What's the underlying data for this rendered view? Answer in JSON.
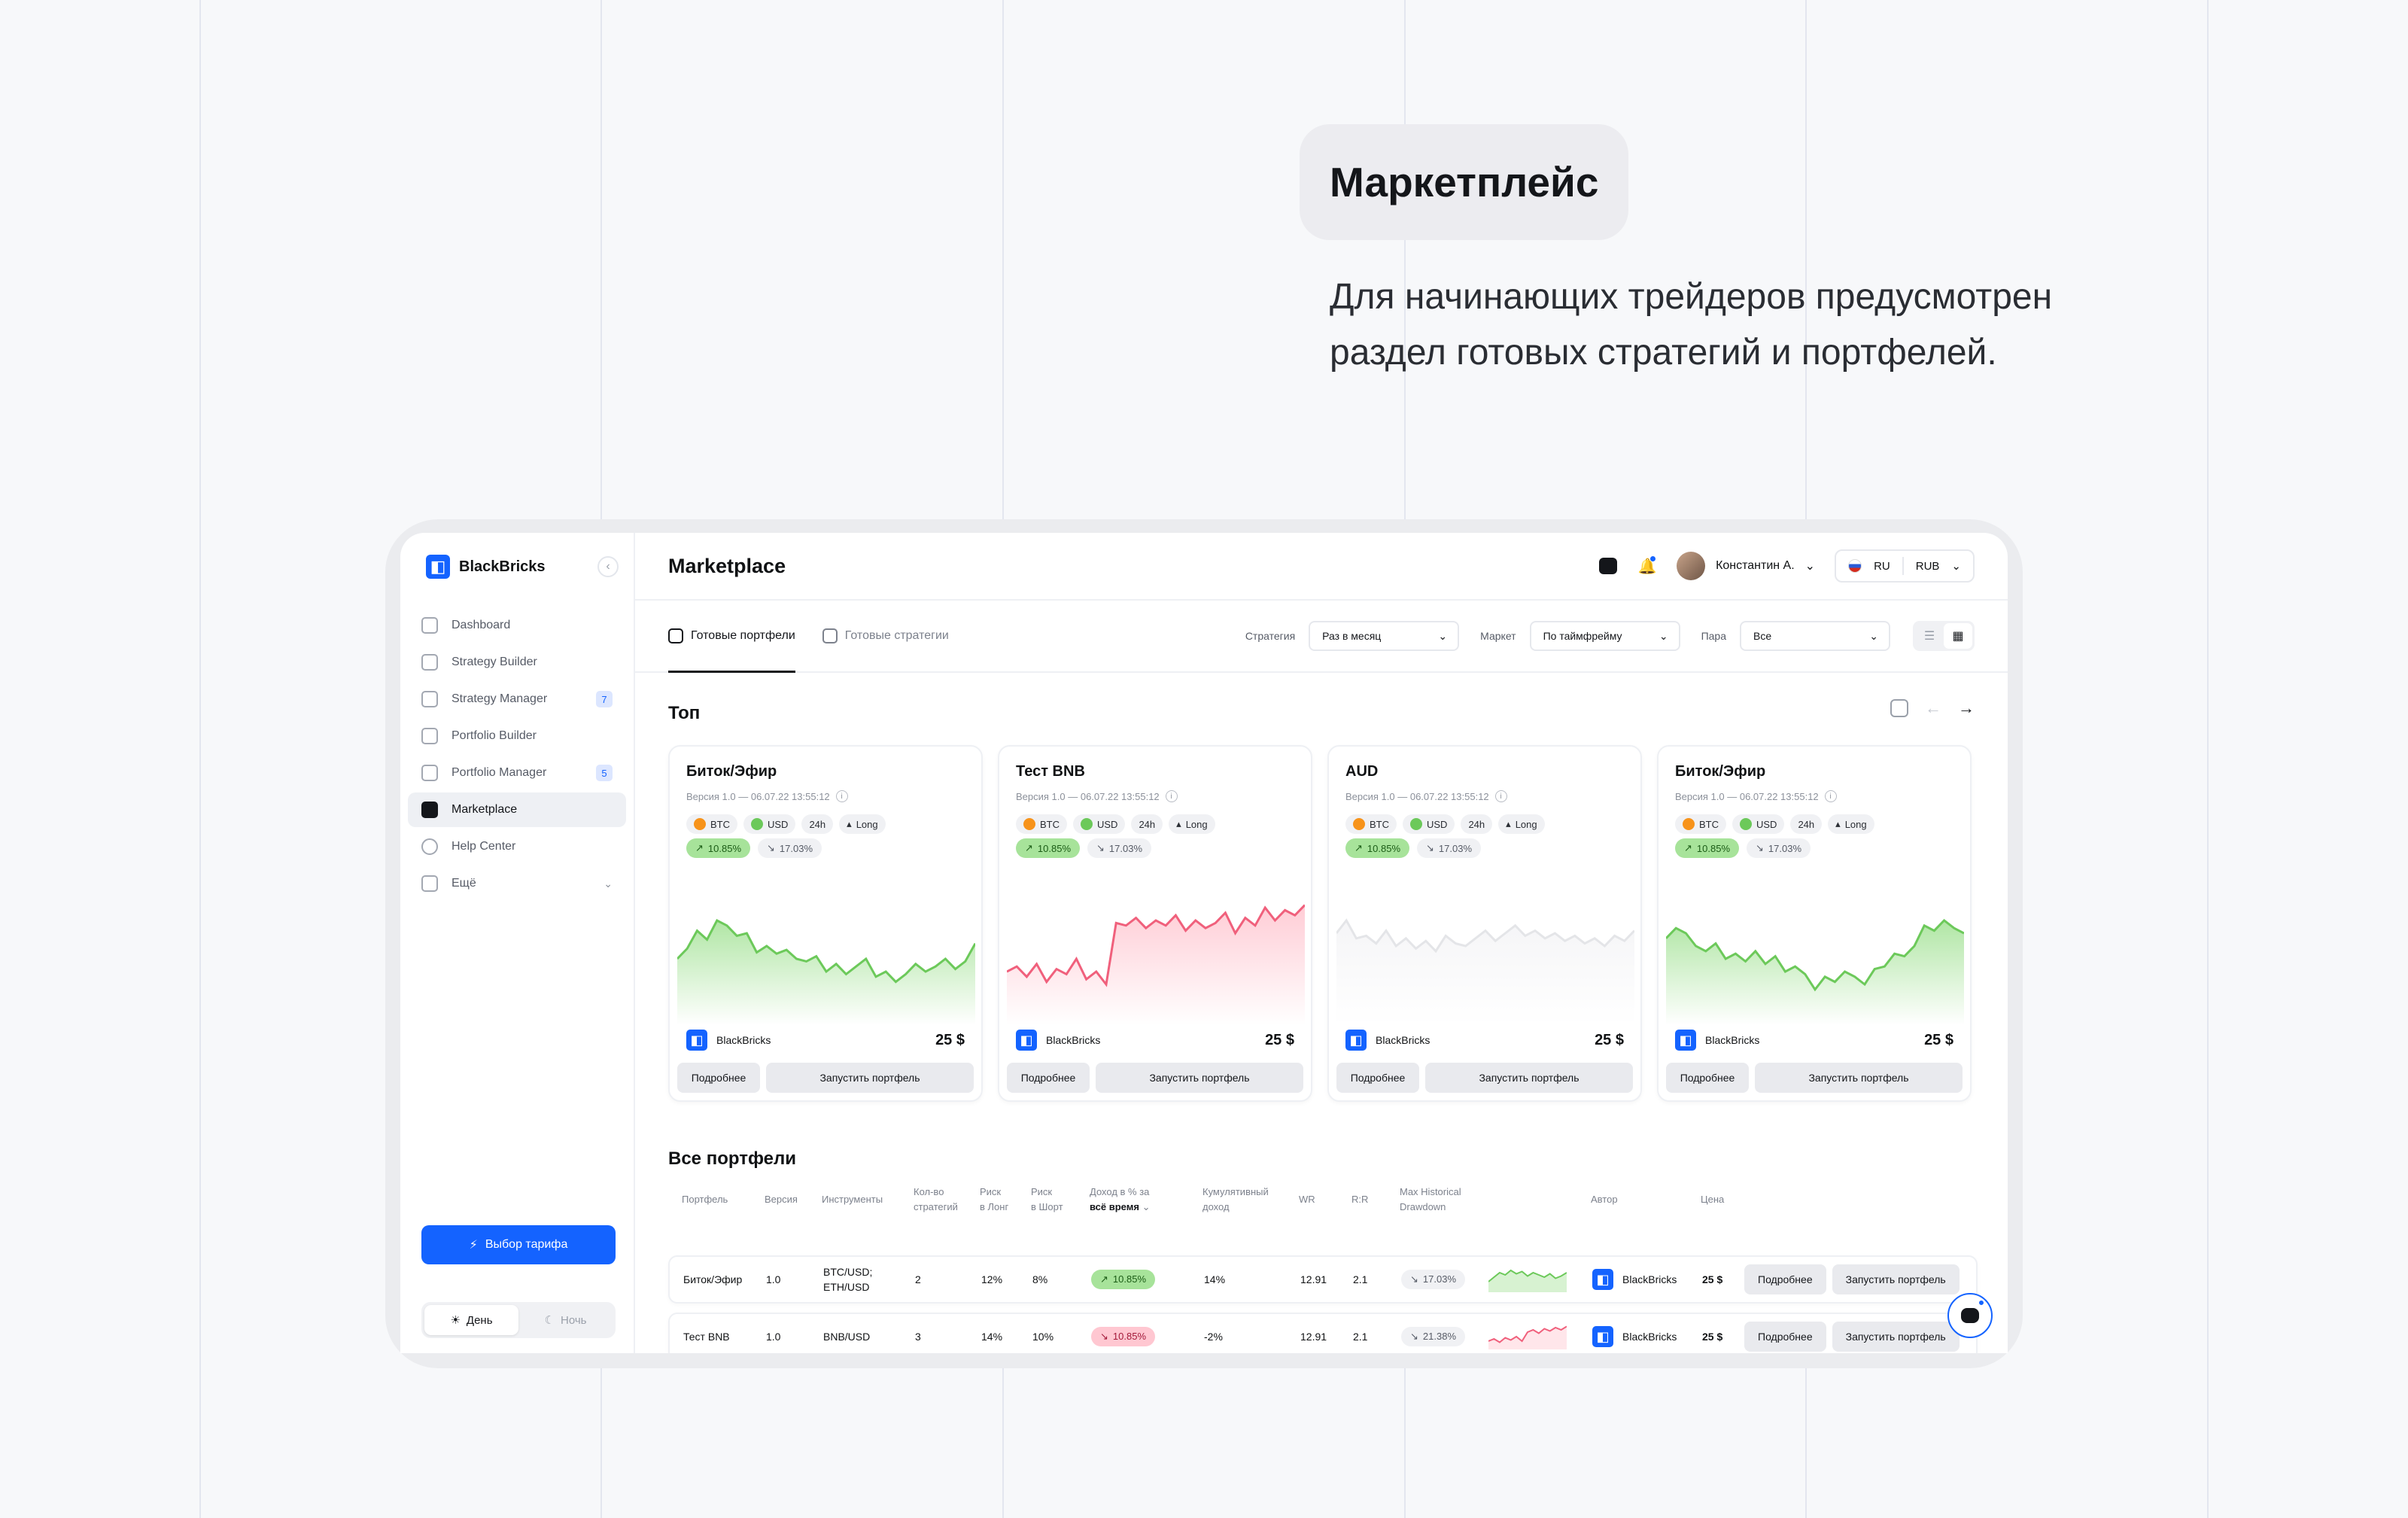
{
  "hero": {
    "heading": "Маркетплейс",
    "description": "Для начинающих трейдеров предусмотрен раздел готовых стратегий и портфелей."
  },
  "brand": {
    "name": "BlackBricks",
    "accent": "#1463ff"
  },
  "sidebar": {
    "items": [
      {
        "label": "Dashboard",
        "icon": "home-icon"
      },
      {
        "label": "Strategy Builder",
        "icon": "builder-icon"
      },
      {
        "label": "Strategy Manager",
        "icon": "grid-icon",
        "badge": "7"
      },
      {
        "label": "Portfolio Builder",
        "icon": "portfolio-add-icon"
      },
      {
        "label": "Portfolio Manager",
        "icon": "portfolio-icon",
        "badge": "5"
      },
      {
        "label": "Marketplace",
        "icon": "marketplace-icon",
        "active": true
      },
      {
        "label": "Help Center",
        "icon": "help-icon"
      },
      {
        "label": "Ещё",
        "icon": "more-icon",
        "expandable": true
      }
    ],
    "tariff_button": "Выбор тарифа",
    "theme": {
      "day": "День",
      "night": "Ночь",
      "selected": "day"
    }
  },
  "topbar": {
    "title": "Marketplace",
    "user_name": "Константин А.",
    "language": "RU",
    "currency": "RUB"
  },
  "tabs": [
    {
      "label": "Готовые портфели",
      "active": true
    },
    {
      "label": "Готовые стратегии",
      "active": false
    }
  ],
  "filters": {
    "strategy_label": "Стратегия",
    "strategy_value": "Раз в месяц",
    "market_label": "Маркет",
    "market_value": "По таймфрейму",
    "pair_label": "Пара",
    "pair_value": "Все"
  },
  "top": {
    "title": "Топ",
    "cards": [
      {
        "title": "Биток/Эфир",
        "version": "Версия 1.0 — 06.07.22 13:55:12",
        "chips": [
          "BTC",
          "USD",
          "24h",
          "Long"
        ],
        "perf_up": "10.85%",
        "perf_dd": "17.03%",
        "author": "BlackBricks",
        "price": "25 $",
        "btn_more": "Подробнее",
        "btn_run": "Запустить портфель",
        "trend": "green",
        "series": [
          40,
          48,
          62,
          55,
          70,
          66,
          58,
          60,
          45,
          50,
          44,
          47,
          40,
          38,
          42,
          30,
          36,
          28,
          34,
          40,
          26,
          30,
          22,
          28,
          36,
          30,
          34,
          40,
          32,
          38,
          52
        ]
      },
      {
        "title": "Тест BNB",
        "version": "Версия 1.0 — 06.07.22 13:55:12",
        "chips": [
          "BTC",
          "USD",
          "24h",
          "Long"
        ],
        "perf_up": "10.85%",
        "perf_dd": "17.03%",
        "author": "BlackBricks",
        "price": "25 $",
        "btn_more": "Подробнее",
        "btn_run": "Запустить портфель",
        "trend": "red",
        "series": [
          30,
          34,
          26,
          36,
          22,
          32,
          28,
          40,
          24,
          30,
          20,
          68,
          66,
          72,
          64,
          70,
          66,
          74,
          62,
          70,
          64,
          68,
          76,
          60,
          72,
          66,
          80,
          70,
          78,
          74,
          82
        ]
      },
      {
        "title": "AUD",
        "version": "Версия 1.0 — 06.07.22 13:55:12",
        "chips": [
          "BTC",
          "USD",
          "24h",
          "Long"
        ],
        "perf_up": "10.85%",
        "perf_dd": "17.03%",
        "author": "BlackBricks",
        "price": "25 $",
        "btn_more": "Подробнее",
        "btn_run": "Запустить портфель",
        "trend": "gray",
        "series": [
          60,
          70,
          56,
          58,
          52,
          62,
          50,
          56,
          48,
          54,
          46,
          58,
          52,
          50,
          56,
          62,
          54,
          60,
          66,
          58,
          62,
          56,
          60,
          54,
          58,
          52,
          56,
          50,
          58,
          54,
          62
        ]
      },
      {
        "title": "Биток/Эфир",
        "version": "Версия 1.0 — 06.07.22 13:55:12",
        "chips": [
          "BTC",
          "USD",
          "24h",
          "Long"
        ],
        "perf_up": "10.85%",
        "perf_dd": "17.03%",
        "author": "BlackBricks",
        "price": "25 $",
        "btn_more": "Подробнее",
        "btn_run": "Запустить портфель",
        "trend": "green",
        "series": [
          56,
          64,
          60,
          50,
          46,
          52,
          40,
          44,
          38,
          46,
          36,
          42,
          30,
          34,
          28,
          16,
          26,
          22,
          30,
          26,
          20,
          32,
          34,
          44,
          42,
          50,
          66,
          62,
          70,
          64,
          60
        ]
      }
    ]
  },
  "all": {
    "title": "Все портфели",
    "headers": {
      "portfolio": "Портфель",
      "version": "Версия",
      "instruments": "Инструменты",
      "count_1": "Кол-во",
      "count_2": "стратегий",
      "risk_long_1": "Риск",
      "risk_long_2": "в Лонг",
      "risk_short_1": "Риск",
      "risk_short_2": "в Шорт",
      "income_1": "Доход в % за",
      "income_2": "всё время",
      "cumul_1": "Кумулятивный",
      "cumul_2": "доход",
      "wr": "WR",
      "rr": "R:R",
      "mhd_1": "Max Historical",
      "mhd_2": "Drawdown",
      "author": "Автор",
      "price": "Цена"
    },
    "rows": [
      {
        "name": "Биток/Эфир",
        "version": "1.0",
        "inst_1": "BTC/USD;",
        "inst_2": "ETH/USD",
        "count": "2",
        "risk_long": "12%",
        "risk_short": "8%",
        "income": "10.85%",
        "income_trend": "up",
        "cumul": "14%",
        "wr": "12.91",
        "rr": "2.1",
        "mhd": "17.03%",
        "author": "BlackBricks",
        "price": "25 $",
        "btn_more": "Подробнее",
        "btn_run": "Запустить портфель",
        "series": [
          8,
          12,
          16,
          14,
          18,
          15,
          17,
          13,
          16,
          14,
          12,
          15,
          11,
          13,
          16
        ]
      },
      {
        "name": "Тест BNB",
        "version": "1.0",
        "inst_1": "BNB/USD",
        "inst_2": "",
        "count": "3",
        "risk_long": "14%",
        "risk_short": "10%",
        "income": "10.85%",
        "income_trend": "down",
        "cumul": "-2%",
        "wr": "12.91",
        "rr": "2.1",
        "mhd": "21.38%",
        "author": "BlackBricks",
        "price": "25 $",
        "btn_more": "Подробнее",
        "btn_run": "Запустить портфель",
        "series": [
          6,
          8,
          5,
          9,
          7,
          10,
          6,
          14,
          16,
          13,
          17,
          15,
          18,
          16,
          19
        ]
      }
    ]
  }
}
